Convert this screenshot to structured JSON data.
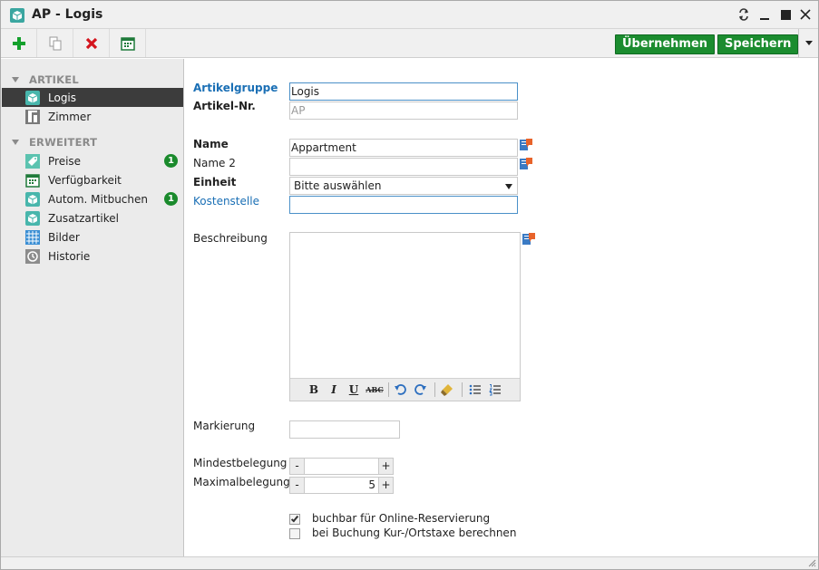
{
  "window": {
    "title": "AP - Logis",
    "app_icon": "cube-icon",
    "controls": [
      "restore-icon",
      "minimize-icon",
      "maximize-icon",
      "close-icon"
    ]
  },
  "toolbar": {
    "icons": [
      "add-icon",
      "copy-icon",
      "delete-icon",
      "calendar-export-icon"
    ],
    "apply_label": "Übernehmen",
    "save_label": "Speichern",
    "accent": "#1b8c2f"
  },
  "sidebar": {
    "sections": [
      {
        "title": "ARTIKEL",
        "items": [
          {
            "label": "Logis",
            "icon": "cube-icon",
            "active": true
          },
          {
            "label": "Zimmer",
            "icon": "door-icon"
          }
        ]
      },
      {
        "title": "ERWEITERT",
        "items": [
          {
            "label": "Preise",
            "icon": "price-tag-icon",
            "badge": "1"
          },
          {
            "label": "Verfügbarkeit",
            "icon": "calendar-icon"
          },
          {
            "label": "Autom. Mitbuchen",
            "icon": "cube-icon",
            "badge": "1"
          },
          {
            "label": "Zusatzartikel",
            "icon": "cube-icon"
          },
          {
            "label": "Bilder",
            "icon": "grid-icon"
          },
          {
            "label": "Historie",
            "icon": "history-icon"
          }
        ]
      }
    ]
  },
  "form": {
    "artikelgruppe": {
      "label": "Artikelgruppe",
      "value": "Logis"
    },
    "artikelnr": {
      "label": "Artikel-Nr.",
      "placeholder": "AP"
    },
    "name": {
      "label": "Name",
      "value": "Appartment"
    },
    "name2": {
      "label": "Name 2",
      "value": ""
    },
    "einheit": {
      "label": "Einheit",
      "value": "Bitte auswählen"
    },
    "kostenstelle": {
      "label": "Kostenstelle",
      "value": ""
    },
    "beschreibung": {
      "label": "Beschreibung",
      "value": ""
    },
    "editor_tools": [
      "bold-icon",
      "italic-icon",
      "underline-icon",
      "strikethrough-icon",
      "undo-icon",
      "redo-icon",
      "clear-format-icon",
      "bullet-list-icon",
      "numbered-list-icon"
    ],
    "editor_labels": {
      "bold": "B",
      "italic": "I",
      "underline": "U",
      "strike": "ABC"
    },
    "markierung": {
      "label": "Markierung",
      "value": ""
    },
    "mindestbelegung": {
      "label": "Mindestbelegung",
      "value": ""
    },
    "maximalbelegung": {
      "label": "Maximalbelegung",
      "value": "5"
    },
    "stepper": {
      "minus": "-",
      "plus": "+"
    },
    "online_reservierung": {
      "label": "buchbar für Online-Reservierung",
      "checked": true
    },
    "kurtaxe": {
      "label": "bei Buchung Kur-/Ortstaxe berechnen",
      "checked": false
    }
  }
}
